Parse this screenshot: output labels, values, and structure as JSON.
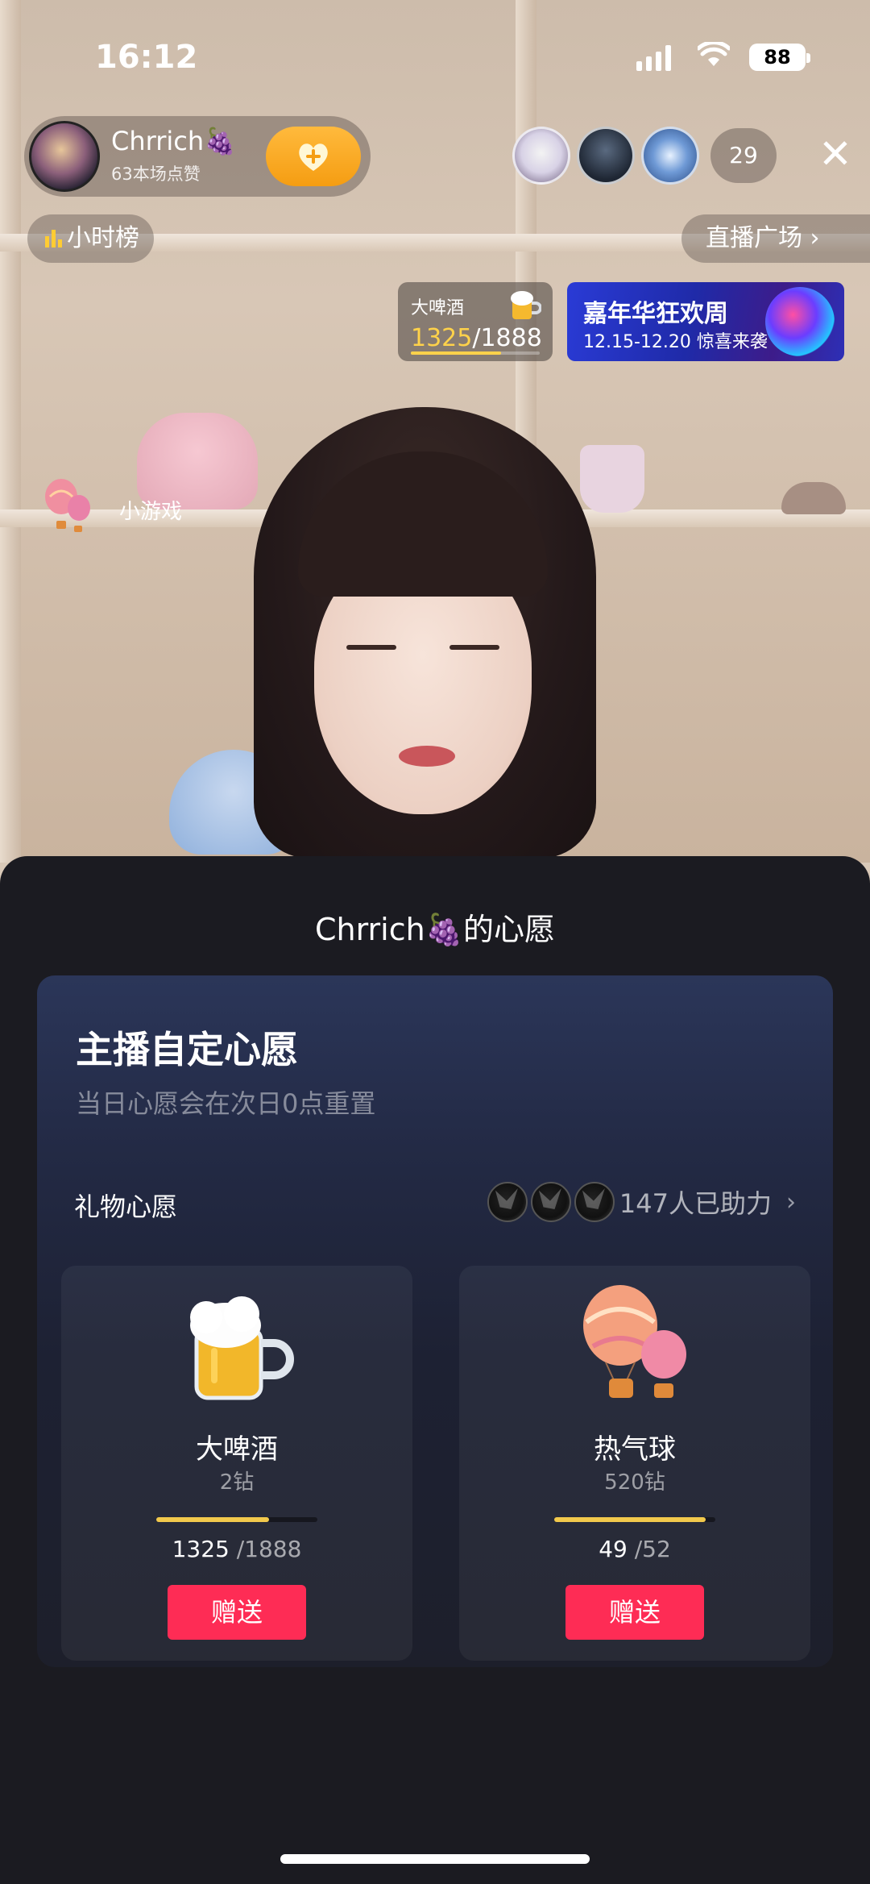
{
  "status_bar": {
    "time": "16:12",
    "battery": "88"
  },
  "host": {
    "name": "Chrrich🍇",
    "sub": "63本场点赞"
  },
  "viewers": {
    "count": "29"
  },
  "chips": {
    "hourly_rank": "小时榜",
    "live_plaza": "直播广场 ›"
  },
  "mini_wish": {
    "label": "大啤酒",
    "current": "1325",
    "total": "/1888",
    "progress": 0.7
  },
  "banner": {
    "title": "嘉年华狂欢周",
    "subtitle": "12.15-12.20 惊喜来袭"
  },
  "mini_game": {
    "label": "小游戏"
  },
  "sheet": {
    "title": "Chrrich🍇的心愿",
    "card_title": "主播自定心愿",
    "card_subtitle": "当日心愿会在次日0点重置",
    "gift_wish_label": "礼物心愿",
    "helpers_text": "147人已助力",
    "gifts": [
      {
        "name": "大啤酒",
        "price": "2钻",
        "current": "1325",
        "total": "/1888",
        "progress": 0.7,
        "send_label": "赠送"
      },
      {
        "name": "热气球",
        "price": "520钻",
        "current": "49",
        "total": "/52",
        "progress": 0.94,
        "send_label": "赠送"
      }
    ]
  },
  "colors": {
    "accent_red": "#fe2c55",
    "progress_yellow": "#f2c94c",
    "follow_orange": "#f59d12"
  }
}
